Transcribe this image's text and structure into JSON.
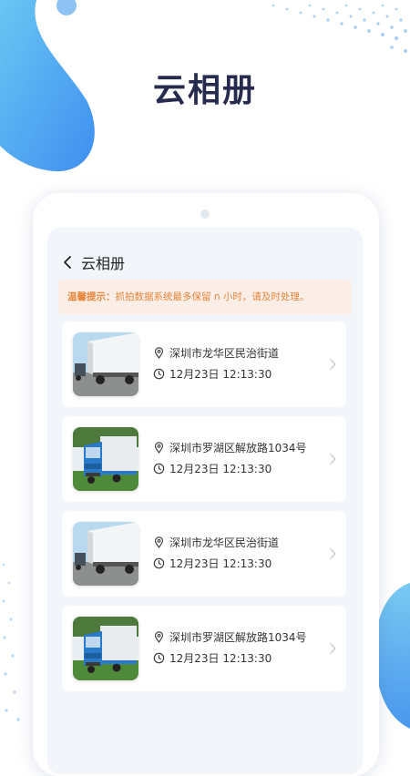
{
  "header": {
    "title": "云相册"
  },
  "nav": {
    "title": "云相册"
  },
  "notice": {
    "label": "温馨提示：",
    "text": "抓拍数据系统最多保留 n 小时，请及时处理。"
  },
  "photos": [
    {
      "location": "深圳市龙华区民治街道",
      "time": "12月23日 12:13:30",
      "thumbnail": "white-truck-side-photo"
    },
    {
      "location": "深圳市罗湖区解放路1034号",
      "time": "12月23日 12:13:30",
      "thumbnail": "blue-truck-front-photo"
    },
    {
      "location": "深圳市龙华区民治街道",
      "time": "12月23日 12:13:30",
      "thumbnail": "white-truck-side-photo"
    },
    {
      "location": "深圳市罗湖区解放路1034号",
      "time": "12月23日 12:13:30",
      "thumbnail": "blue-truck-front-photo"
    }
  ],
  "icons": {
    "back": "chevron-left-icon",
    "location": "location-pin-icon",
    "time": "clock-icon",
    "open": "chevron-right-icon"
  },
  "colors": {
    "accent": "#5aa8f5",
    "notice_text": "#e7863c",
    "notice_bg": "#fbeee6",
    "title": "#262b4e"
  }
}
